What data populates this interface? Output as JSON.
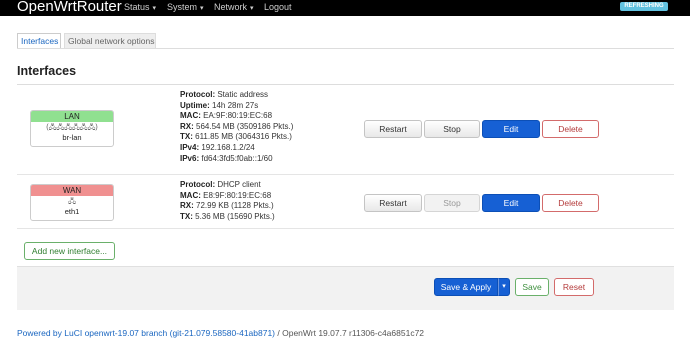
{
  "topbar": {
    "brand": "OpenWrtRouter",
    "menu": [
      {
        "label": "Status",
        "caret": "▾"
      },
      {
        "label": "System",
        "caret": "▾"
      },
      {
        "label": "Network",
        "caret": "▾"
      },
      {
        "label": "Logout",
        "caret": ""
      }
    ],
    "badge": "REFRESHING"
  },
  "tabs": [
    {
      "label": "Interfaces",
      "active": true
    },
    {
      "label": "Global network options",
      "active": false
    }
  ],
  "section_title": "Interfaces",
  "interfaces": [
    {
      "name": "LAN",
      "header_color": "#90e090",
      "icons": "(🖧🖧🖧🖧🖧🖧)",
      "device": "br-lan",
      "details": [
        {
          "k": "Protocol:",
          "v": " Static address"
        },
        {
          "k": "Uptime:",
          "v": " 14h 28m 27s"
        },
        {
          "k": "MAC:",
          "v": " EA:9F:80:19:EC:68"
        },
        {
          "k": "RX:",
          "v": " 564.54 MB (3509186 Pkts.)"
        },
        {
          "k": "TX:",
          "v": " 611.85 MB (3064316 Pkts.)"
        },
        {
          "k": "IPv4:",
          "v": " 192.168.1.2/24"
        },
        {
          "k": "IPv6:",
          "v": " fd64:3fd5:f0ab::1/60"
        }
      ],
      "buttons": {
        "restart": "Restart",
        "stop": "Stop",
        "edit": "Edit",
        "delete": "Delete"
      }
    },
    {
      "name": "WAN",
      "header_color": "#f09090",
      "icons": "🖧",
      "device": "eth1",
      "details": [
        {
          "k": "Protocol:",
          "v": " DHCP client"
        },
        {
          "k": "MAC:",
          "v": " E8:9F:80:19:EC:68"
        },
        {
          "k": "RX:",
          "v": " 72.99 KB (1128 Pkts.)"
        },
        {
          "k": "TX:",
          "v": " 5.36 MB (15690 Pkts.)"
        }
      ],
      "buttons": {
        "restart": "Restart",
        "stop": "Stop",
        "edit": "Edit",
        "delete": "Delete"
      }
    }
  ],
  "add_button": "Add new interface...",
  "actions": {
    "save_apply": "Save & Apply",
    "caret": "▾",
    "save": "Save",
    "reset": "Reset"
  },
  "footer": {
    "powered_prefix": "Powered by ",
    "luci_link": "LuCI openwrt-19.07 branch (git-21.079.58580-41ab871)",
    "suffix": " / OpenWrt 19.07.7 r11306-c4a6851c72"
  }
}
